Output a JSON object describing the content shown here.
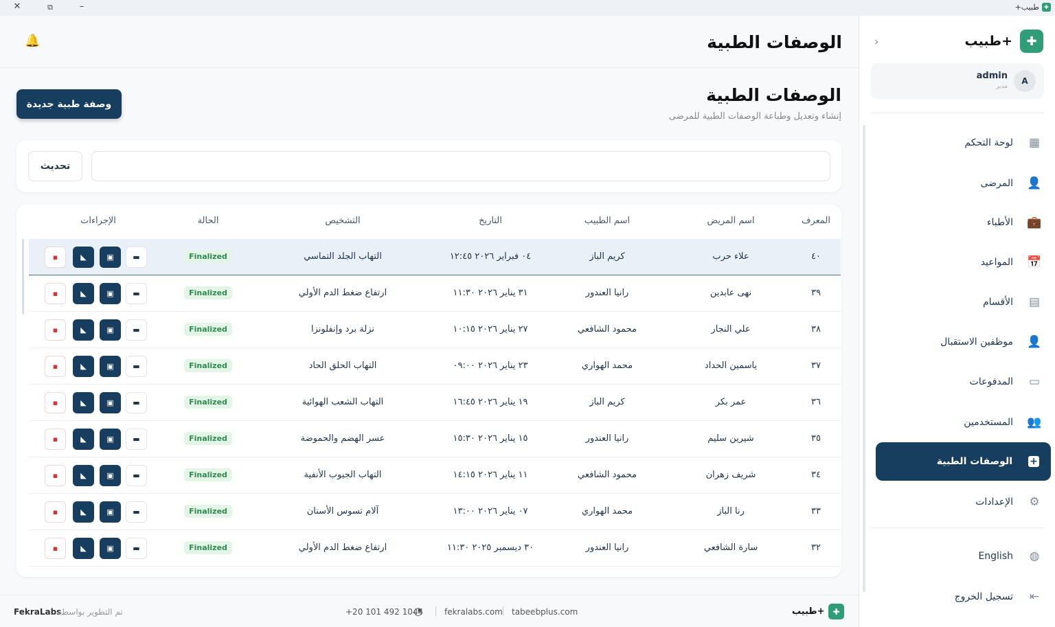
{
  "window": {
    "title": "طبيب+"
  },
  "header": {
    "title": "الوصفات الطبية"
  },
  "page": {
    "title": "الوصفات الطبية",
    "subtitle": "إنشاء وتعديل وطباعة الوصفات الطبية للمرضى",
    "new_button": "وصفة طبية جديدة"
  },
  "search": {
    "refresh_label": "تحديث",
    "placeholder": ""
  },
  "sidebar": {
    "brand": "طبيب+",
    "user": {
      "initial": "A",
      "name": "admin",
      "role": "مدير"
    },
    "items": [
      {
        "label": "لوحة التحكم",
        "icon": "dashboard-icon"
      },
      {
        "label": "المرضى",
        "icon": "person-icon"
      },
      {
        "label": "الأطباء",
        "icon": "briefcase-icon"
      },
      {
        "label": "المواعيد",
        "icon": "calendar-icon"
      },
      {
        "label": "الأقسام",
        "icon": "building-icon"
      },
      {
        "label": "موظفين الاستقبال",
        "icon": "person-icon"
      },
      {
        "label": "المدفوعات",
        "icon": "card-icon"
      },
      {
        "label": "المستخدمين",
        "icon": "users-icon"
      },
      {
        "label": "الوصفات الطبية",
        "icon": "plus-square-icon"
      },
      {
        "label": "الإعدادات",
        "icon": "gear-icon"
      }
    ],
    "language": "English",
    "logout": "تسجيل الخروج"
  },
  "table": {
    "headers": [
      "المعرف",
      "اسم المريض",
      "اسم الطبيب",
      "التاريخ",
      "التشخيص",
      "الحالة",
      "الإجراءات"
    ],
    "rows": [
      {
        "id": "٤٠",
        "patient": "علاء حرب",
        "doctor": "كريم الباز",
        "date": "٠٤ فبراير ٢٠٢٦ ١٢:٤٥",
        "diagnosis": "التهاب الجلد التماسي",
        "status": "Finalized"
      },
      {
        "id": "٣٩",
        "patient": "نهى عابدين",
        "doctor": "رانيا العندور",
        "date": "٣١ يناير ٢٠٢٦ ١١:٣٠",
        "diagnosis": "ارتفاع ضغط الدم الأولي",
        "status": "Finalized"
      },
      {
        "id": "٣٨",
        "patient": "علي النجار",
        "doctor": "محمود الشافعي",
        "date": "٢٧ يناير ٢٠٢٦ ١٠:١٥",
        "diagnosis": "نزلة برد وإنفلونزا",
        "status": "Finalized"
      },
      {
        "id": "٣٧",
        "patient": "ياسمين الحداد",
        "doctor": "محمد الهواري",
        "date": "٢٣ يناير ٢٠٢٦ ٠٩:٠٠",
        "diagnosis": "التهاب الحلق الحاد",
        "status": "Finalized"
      },
      {
        "id": "٣٦",
        "patient": "عمر بكر",
        "doctor": "كريم الباز",
        "date": "١٩ يناير ٢٠٢٦ ١٦:٤٥",
        "diagnosis": "التهاب الشعب الهوائية",
        "status": "Finalized"
      },
      {
        "id": "٣٥",
        "patient": "شيرين سليم",
        "doctor": "رانيا العندور",
        "date": "١٥ يناير ٢٠٢٦ ١٥:٣٠",
        "diagnosis": "عسر الهضم والحموضة",
        "status": "Finalized"
      },
      {
        "id": "٣٤",
        "patient": "شريف زهران",
        "doctor": "محمود الشافعي",
        "date": "١١ يناير ٢٠٢٦ ١٤:١٥",
        "diagnosis": "التهاب الجيوب الأنفية",
        "status": "Finalized"
      },
      {
        "id": "٣٣",
        "patient": "رنا الباز",
        "doctor": "محمد الهواري",
        "date": "٠٧ يناير ٢٠٢٦ ١٣:٠٠",
        "diagnosis": "آلام تسوس الأسنان",
        "status": "Finalized"
      },
      {
        "id": "٣٢",
        "patient": "سارة الشافعي",
        "doctor": "رانيا العندور",
        "date": "٣٠ ديسمبر ٢٠٢٥ ١١:٣٠",
        "diagnosis": "ارتفاع ضغط الدم الأولي",
        "status": "Finalized"
      }
    ]
  },
  "footer": {
    "brand": "طبيب+",
    "site1": "tabeebplus.com",
    "site2": "fekralabs.com",
    "phone": "+20 101 492 1044",
    "developed_by": "تم التطوير بواسطة",
    "company": "FekraLabs"
  },
  "colors": {
    "primary": "#173e5f",
    "brand_green": "#2f9d78",
    "status_green": "#2f8a52",
    "danger": "#d93232"
  }
}
